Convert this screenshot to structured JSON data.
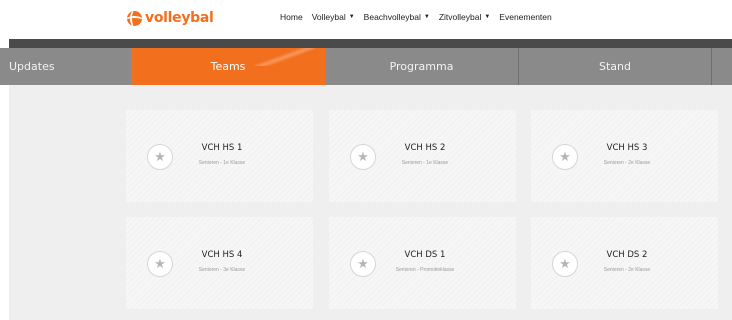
{
  "logo": {
    "text": "volleybal",
    "brand_color": "#f26f1e"
  },
  "nav": [
    {
      "label": "Home",
      "dropdown": false
    },
    {
      "label": "Volleybal",
      "dropdown": true
    },
    {
      "label": "Beachvolleybal",
      "dropdown": true
    },
    {
      "label": "Zitvolleybal",
      "dropdown": true
    },
    {
      "label": "Evenementen",
      "dropdown": false
    }
  ],
  "tabs": [
    {
      "label": "Updates",
      "active": false
    },
    {
      "label": "Teams",
      "active": true
    },
    {
      "label": "Programma",
      "active": false
    },
    {
      "label": "Stand",
      "active": false
    }
  ],
  "teams": [
    {
      "name": "VCH HS 1",
      "category": "Senioren - 1e Klasse",
      "icon": "star-icon"
    },
    {
      "name": "VCH HS 2",
      "category": "Senioren - 1e Klasse",
      "icon": "star-icon"
    },
    {
      "name": "VCH HS 3",
      "category": "Senioren - 2e Klasse",
      "icon": "star-icon"
    },
    {
      "name": "VCH HS 4",
      "category": "Senioren - 3e Klasse",
      "icon": "star-icon"
    },
    {
      "name": "VCH DS 1",
      "category": "Senioren - Promotieklasse",
      "icon": "star-icon"
    },
    {
      "name": "VCH DS 2",
      "category": "Senioren - 2e Klasse",
      "icon": "star-icon"
    }
  ],
  "colors": {
    "accent": "#f26f1e",
    "tabbar": "#8a8a8a",
    "strip": "#4a4a4a",
    "background": "#efefef"
  }
}
